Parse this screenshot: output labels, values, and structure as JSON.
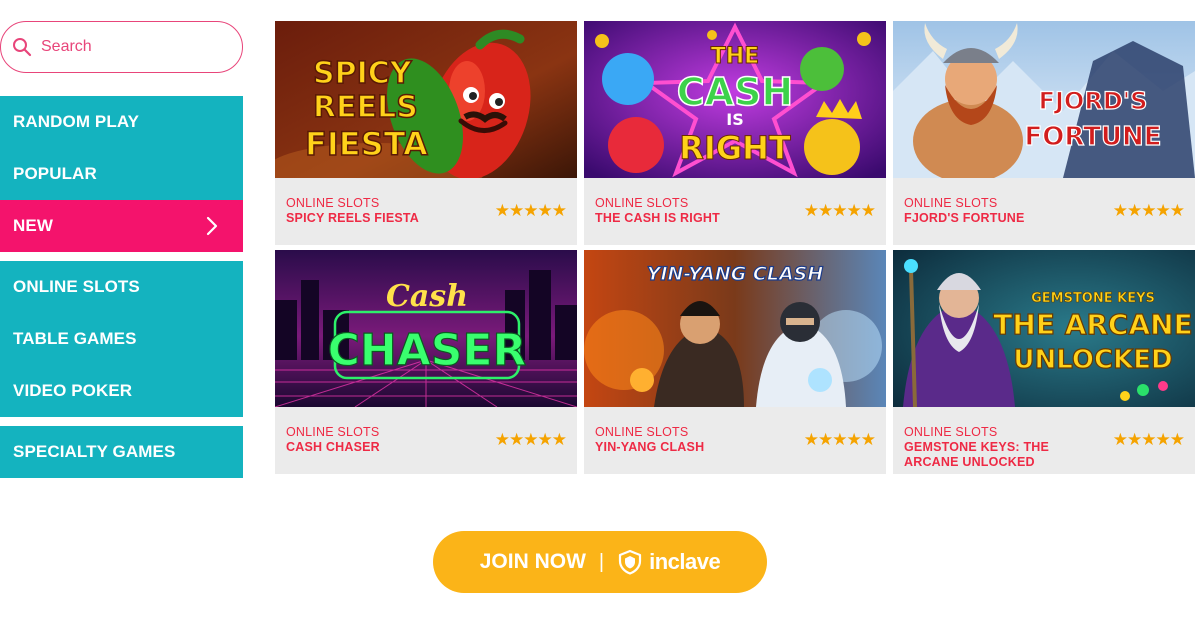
{
  "search": {
    "placeholder": "Search",
    "icon": "search-icon"
  },
  "sidebar": {
    "group1": [
      {
        "label": "RANDOM PLAY",
        "active": false
      },
      {
        "label": "POPULAR",
        "active": false
      },
      {
        "label": "NEW",
        "active": true,
        "icon": "chevron-right-icon"
      }
    ],
    "group2": [
      {
        "label": "ONLINE SLOTS"
      },
      {
        "label": "TABLE GAMES"
      },
      {
        "label": "VIDEO POKER"
      }
    ],
    "group3": [
      {
        "label": "SPECIALTY GAMES"
      }
    ]
  },
  "games": [
    {
      "category": "ONLINE SLOTS",
      "name": "SPICY REELS FIESTA",
      "rating": 5,
      "art_title": [
        "SPICY",
        "REELS",
        "FIESTA"
      ]
    },
    {
      "category": "ONLINE SLOTS",
      "name": "THE CASH IS RIGHT",
      "rating": 5,
      "art_title": [
        "THE",
        "CASH",
        "IS",
        "RIGHT"
      ]
    },
    {
      "category": "ONLINE SLOTS",
      "name": "FJORD'S FORTUNE",
      "rating": 5,
      "art_title": [
        "FJORD'S",
        "FORTUNE"
      ]
    },
    {
      "category": "ONLINE SLOTS",
      "name": "CASH CHASER",
      "rating": 5,
      "art_title": [
        "Cash",
        "CHASER"
      ]
    },
    {
      "category": "ONLINE SLOTS",
      "name": "YIN-YANG CLASH",
      "rating": 5,
      "art_title": [
        "YIN-YANG CLASH"
      ]
    },
    {
      "category": "ONLINE SLOTS",
      "name": "GEMSTONE KEYS: THE ARCANE UNLOCKED",
      "rating": 5,
      "art_title": [
        "GEMSTONE KEYS",
        "THE ARCANE",
        "UNLOCKED"
      ]
    }
  ],
  "join": {
    "label": "JOIN NOW",
    "separator": "|",
    "brand": "inclave",
    "brand_icon": "inclave-shield-icon"
  },
  "colors": {
    "teal": "#14b3bf",
    "pink": "#f4136c",
    "text_red": "#ee2a45",
    "star": "#f5a300",
    "button": "#fbb418"
  }
}
